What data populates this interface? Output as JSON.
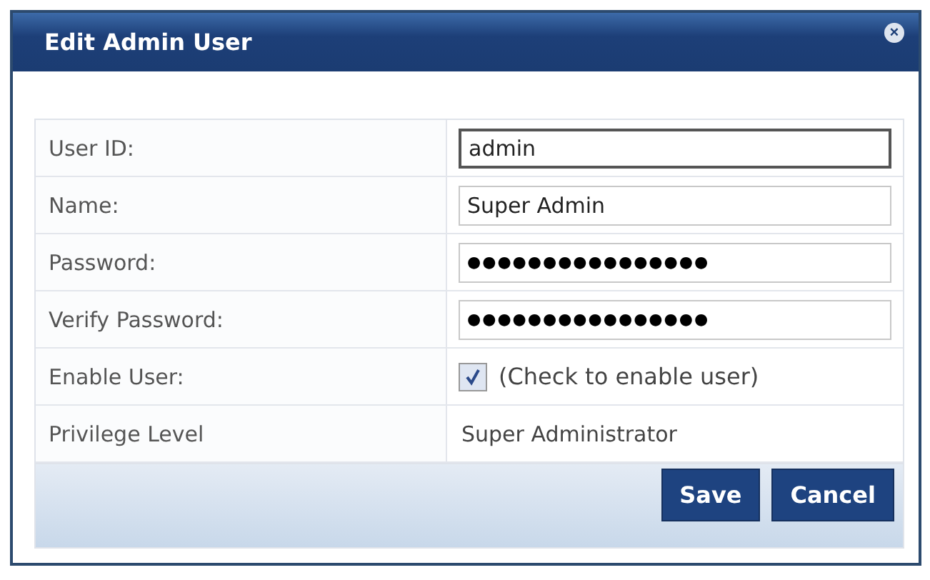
{
  "dialog": {
    "title": "Edit Admin User",
    "close": "×"
  },
  "rows": [
    {
      "label": "User ID:",
      "kind": "text",
      "value": "admin",
      "focused": true
    },
    {
      "label": "Name:",
      "kind": "text",
      "value": "Super Admin",
      "focused": false
    },
    {
      "label": "Password:",
      "kind": "password",
      "value": "●●●●●●●●●●●●●●●●",
      "focused": false
    },
    {
      "label": "Verify Password:",
      "kind": "password",
      "value": "●●●●●●●●●●●●●●●●",
      "focused": false
    },
    {
      "label": "Enable User:",
      "kind": "checkbox",
      "checked": true,
      "value": "(Check to enable user)"
    },
    {
      "label": "Privilege Level",
      "kind": "static",
      "value": "Super Administrator"
    }
  ],
  "buttons": [
    "Save",
    "Cancel"
  ]
}
